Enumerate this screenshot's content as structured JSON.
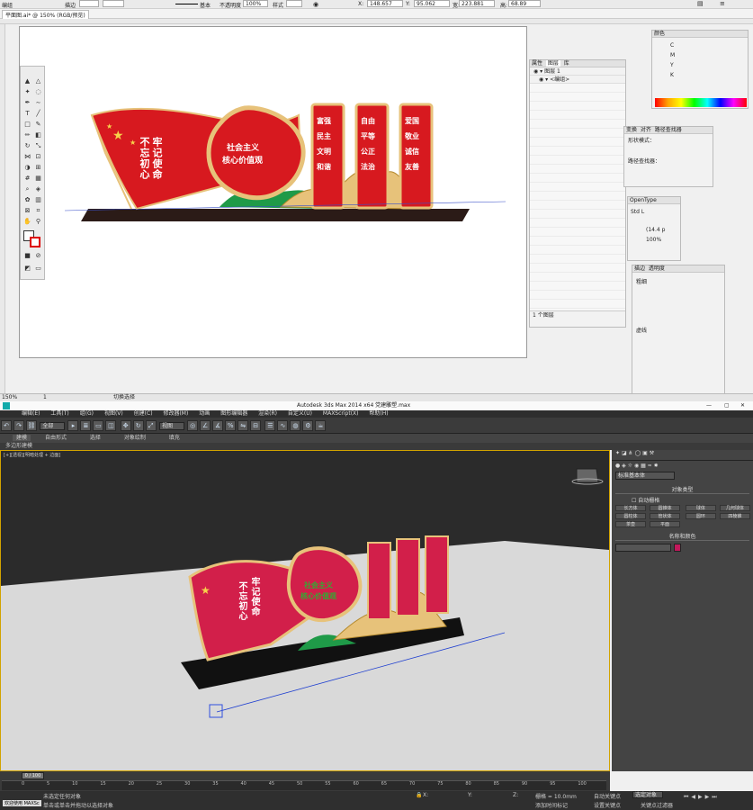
{
  "ai": {
    "menu_left": "编组",
    "control": {
      "stroke_label": "描边",
      "weight_label": "基本",
      "opacity_label": "不透明度",
      "opacity_value": "100%",
      "style_label": "样式",
      "x_value": "148.657",
      "y_value": "95.062",
      "w_value": "223.881",
      "h_value": "68.89"
    },
    "doc_tab": "平面图.ai* @ 150% (RGB/预览)",
    "zoom": "150%",
    "page_num": "1",
    "status_tool": "切换选择",
    "layers_panel": {
      "tabs": [
        "属性",
        "图层",
        "库"
      ],
      "layer_name": "图层 1",
      "group_name": "<编组>",
      "footer": "1 个图层"
    },
    "color_panel": {
      "title": "颜色",
      "channels": [
        "C",
        "M",
        "Y",
        "K"
      ]
    },
    "pathfinder_panel": {
      "tabs": [
        "变换",
        "对齐",
        "路径查找器"
      ],
      "mode_label": "形状模式：",
      "finder_label": "路径查找器："
    },
    "char_panel": {
      "tab": "OpenType",
      "font": "Std L",
      "size": "(14.4 p",
      "scale": "100%"
    },
    "stroke_panel": {
      "tabs": [
        "描边",
        "透明度"
      ],
      "weight_label": "粗细",
      "dash_label": "虚线"
    },
    "art": {
      "left_text": [
        "牢",
        "记",
        "使",
        "命",
        "不",
        "忘",
        "初",
        "心"
      ],
      "circle_text_1": "社会主义",
      "circle_text_2": "核心价值观",
      "panel1": [
        "富强",
        "民主",
        "文明",
        "和谐"
      ],
      "panel2": [
        "自由",
        "平等",
        "公正",
        "法治"
      ],
      "panel3": [
        "爱国",
        "敬业",
        "诚信",
        "友善"
      ]
    }
  },
  "max": {
    "title": "Autodesk 3ds Max 2014 x64    党建雕塑.max",
    "menu": [
      "编辑(E)",
      "工具(T)",
      "组(G)",
      "视图(V)",
      "创建(C)",
      "修改器(M)",
      "动画",
      "图形编辑器",
      "渲染(R)",
      "自定义(U)",
      "MAXScript(X)",
      "帮助(H)"
    ],
    "selection_filter": "全部",
    "view_dropdown": "视图",
    "ribbon_tabs": [
      "建模",
      "自由形式",
      "选择",
      "对象绘制",
      "填充"
    ],
    "sub_label": "多边形建模",
    "viewport_label": "[+][透视][明暗处理 + 边面]",
    "cmd": {
      "dropdown": "标准基本体",
      "rollout_title": "对象类型",
      "autogrid": "自动栅格",
      "buttons": [
        "长方体",
        "圆锥体",
        "球体",
        "几何球体",
        "圆柱体",
        "管状体",
        "圆环",
        "四棱锥",
        "茶壶",
        "平面"
      ],
      "name_title": "名称和颜色",
      "swatch": "#c2185b"
    },
    "frame": "0 / 100",
    "ticks": [
      "0",
      "5",
      "10",
      "15",
      "20",
      "25",
      "30",
      "35",
      "40",
      "45",
      "50",
      "55",
      "60",
      "65",
      "70",
      "75",
      "80",
      "85",
      "90",
      "95",
      "100"
    ],
    "status": {
      "line1": "未选定任何对象",
      "line2": "单击或单击并拖动以选择对象",
      "welcome": "欢迎使用 MAXSc",
      "grid": "栅格 = 10.0mm",
      "autokey": "自动关键点",
      "keymode": "选定对象",
      "setkey": "设置关键点",
      "keyfilter": "关键点过滤器",
      "addtime": "添加时间标记"
    }
  },
  "colors": {
    "red": "#d7191f",
    "magenta": "#d21f4a",
    "gold": "#e7c27a",
    "green": "#1f9a48",
    "black": "#2b1b17",
    "purple": "#8a1da0"
  }
}
